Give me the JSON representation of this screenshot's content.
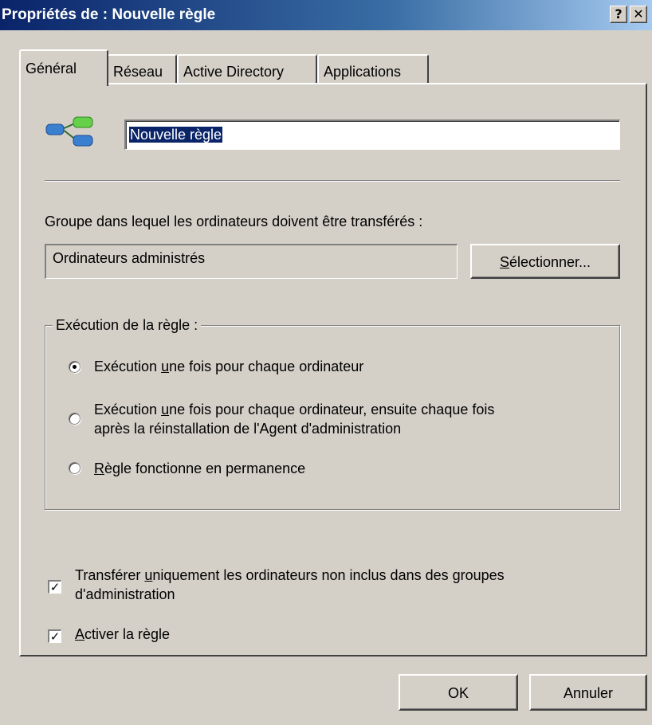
{
  "window": {
    "title": "Propriétés de : Nouvelle règle",
    "help_button": "?",
    "close_button": "✕"
  },
  "tabs": [
    {
      "label": "Général",
      "active": true
    },
    {
      "label": "Réseau",
      "active": false
    },
    {
      "label": "Active Directory",
      "active": false
    },
    {
      "label": "Applications",
      "active": false
    }
  ],
  "general": {
    "rule_icon": "rule-network-icon",
    "rule_name": "Nouvelle règle",
    "target_group_label": "Groupe dans lequel les ordinateurs doivent être transférés :",
    "target_group_value": "Ordinateurs administrés",
    "select_button": {
      "underlined": "S",
      "rest": "électionner..."
    },
    "execution": {
      "legend": "Exécution de la règle :",
      "options": [
        {
          "before": "Exécution ",
          "underlined": "u",
          "after": "ne fois pour chaque ordinateur",
          "line2": "",
          "selected": true
        },
        {
          "before": "Exécution ",
          "underlined": "u",
          "after": "ne fois pour chaque ordinateur, ensuite chaque fois",
          "line2": "après la réinstallation de l'Agent d'administration",
          "selected": false
        },
        {
          "before": "",
          "underlined": "R",
          "after": "ègle fonctionne en permanence",
          "line2": "",
          "selected": false
        }
      ]
    },
    "transfer_only": {
      "before": "Transférer ",
      "underlined": "u",
      "after": "niquement les ordinateurs non inclus dans des groupes",
      "line2": "d'administration",
      "checked": true
    },
    "activate_rule": {
      "before": "",
      "underlined": "A",
      "after": "ctiver la règle",
      "checked": true
    }
  },
  "footer": {
    "ok_label": "OK",
    "cancel_label": "Annuler"
  },
  "colors": {
    "title_bar": "#0a246a",
    "dialog_bg": "#d4d0c8",
    "selection": "#0a246a"
  }
}
